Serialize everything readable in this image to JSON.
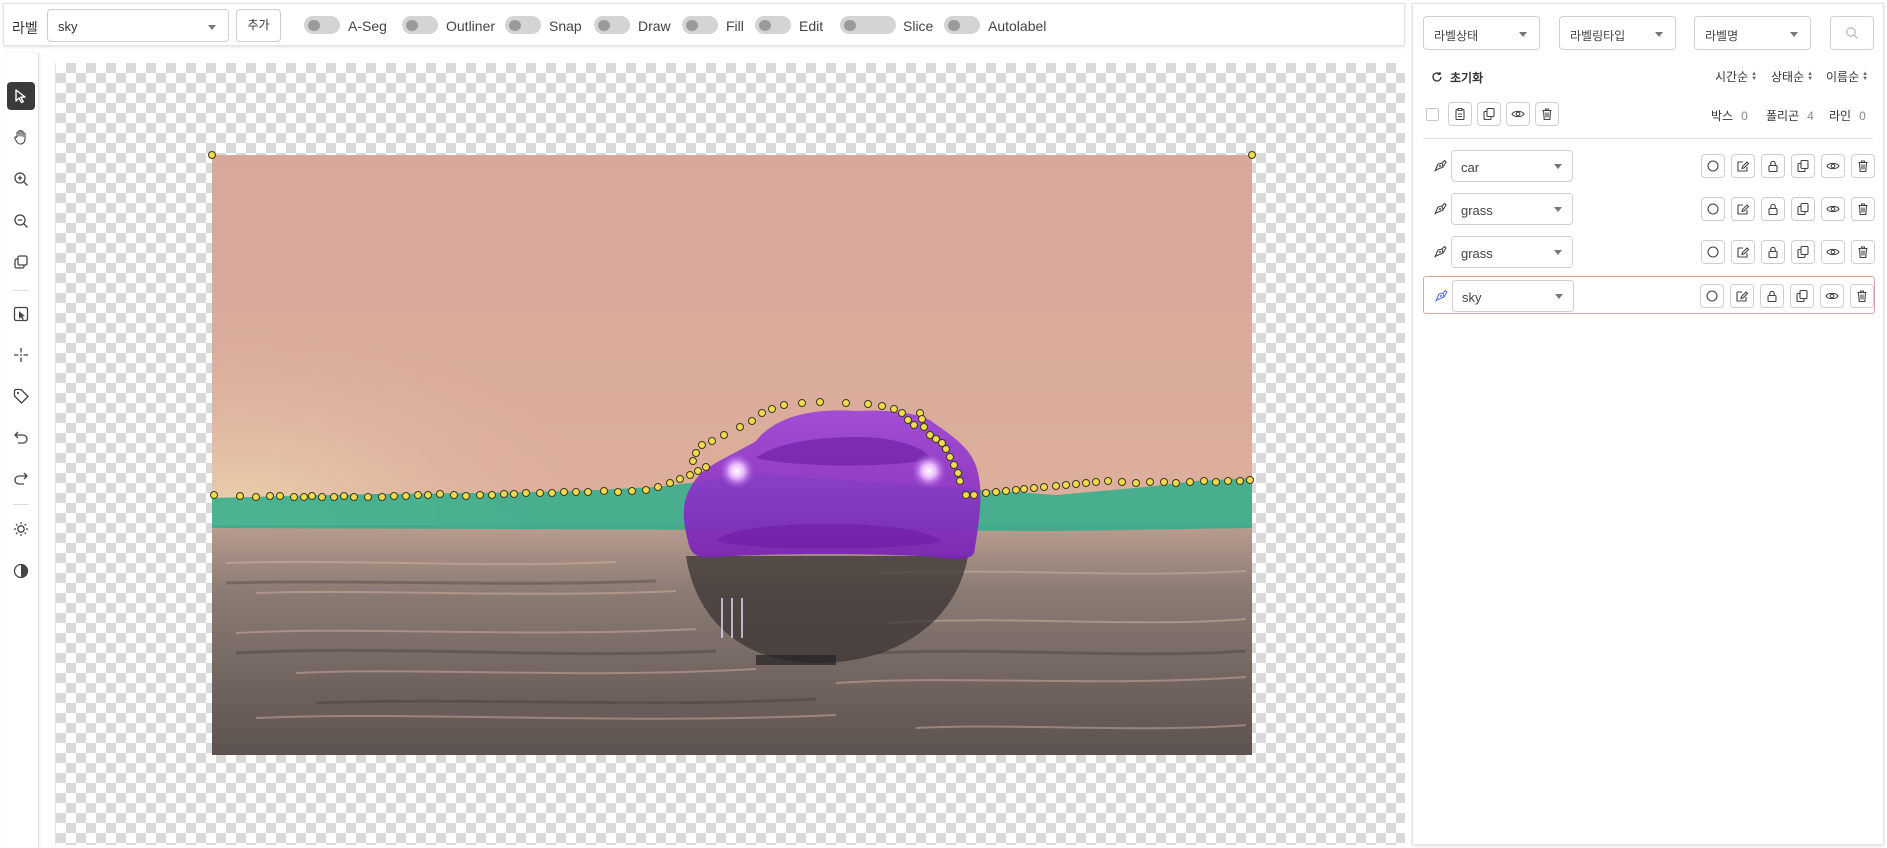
{
  "toolbar": {
    "label_title": "라벨",
    "label_select_value": "sky",
    "add_button": "추가",
    "toggles": [
      {
        "label": "A-Seg",
        "on": false
      },
      {
        "label": "Outliner",
        "on": false
      },
      {
        "label": "Snap",
        "on": false
      },
      {
        "label": "Draw",
        "on": false
      },
      {
        "label": "Fill",
        "on": false
      },
      {
        "label": "Edit",
        "on": false
      },
      {
        "label": "Slice",
        "on": false
      },
      {
        "label": "Autolabel",
        "on": false
      }
    ]
  },
  "tools": [
    {
      "name": "select-pointer-icon",
      "active": true
    },
    {
      "name": "pan-hand-icon"
    },
    {
      "name": "zoom-in-icon"
    },
    {
      "name": "zoom-out-icon"
    },
    {
      "name": "fit-screen-icon"
    },
    {
      "name": "point-select-icon"
    },
    {
      "name": "crosshair-icon"
    },
    {
      "name": "tag-icon"
    },
    {
      "name": "undo-icon"
    },
    {
      "name": "redo-icon"
    },
    {
      "name": "brightness-icon"
    },
    {
      "name": "contrast-icon"
    }
  ],
  "panel": {
    "filters": [
      "라벨상태",
      "라벨링타입",
      "라벨명"
    ],
    "reset_label": "초기화",
    "sort": [
      "시간순",
      "상태순",
      "이름순"
    ],
    "counts": [
      {
        "label": "박스",
        "value": "0"
      },
      {
        "label": "폴리곤",
        "value": "4"
      },
      {
        "label": "라인",
        "value": "0"
      }
    ],
    "annotations": [
      {
        "label": "car",
        "selected": false
      },
      {
        "label": "grass",
        "selected": false
      },
      {
        "label": "grass",
        "selected": false
      },
      {
        "label": "sky",
        "selected": true
      }
    ]
  },
  "colors": {
    "accent": "#3a3a3a",
    "vertex": "#f2d94e",
    "car_mask": "#9a3ad6",
    "grass_mask": "#2fae8c",
    "selected_row_border": "#d9a89c"
  }
}
